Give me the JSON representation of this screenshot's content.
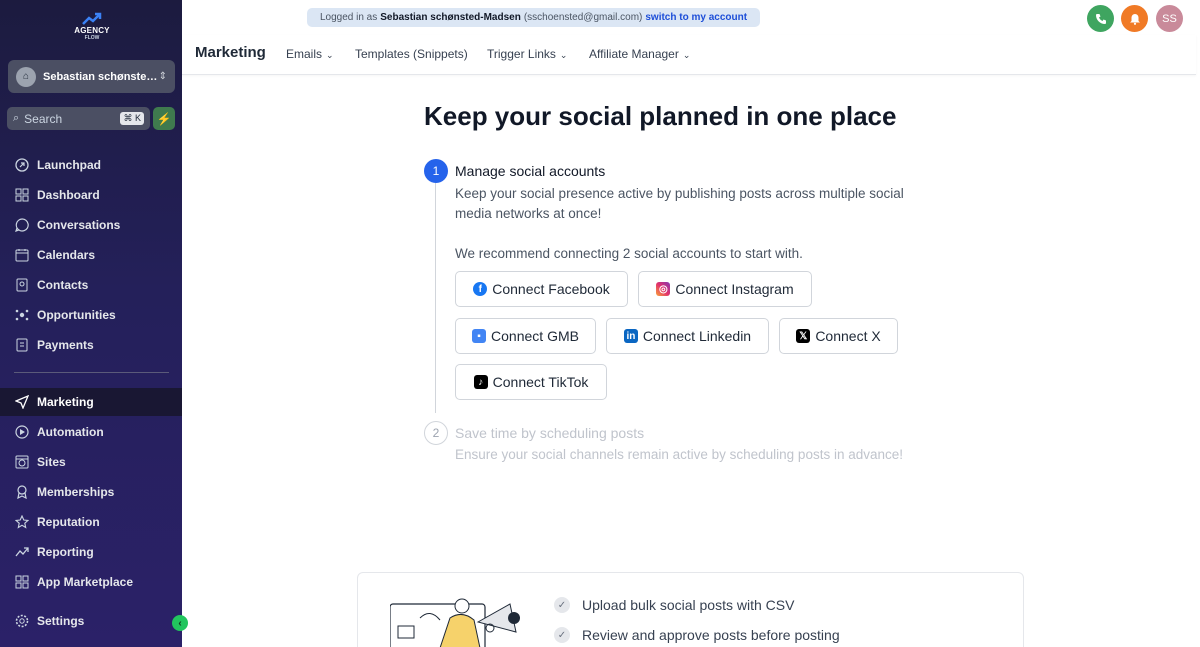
{
  "brand": {
    "logo_line1": "AGENCY",
    "logo_line2": "FLOW"
  },
  "account": {
    "name": "Sebastian schønste…"
  },
  "search": {
    "placeholder": "Search",
    "shortcut": "⌘ K"
  },
  "nav": [
    {
      "label": "Launchpad",
      "icon": "launchpad-icon"
    },
    {
      "label": "Dashboard",
      "icon": "dashboard-icon"
    },
    {
      "label": "Conversations",
      "icon": "chat-icon"
    },
    {
      "label": "Calendars",
      "icon": "calendar-icon"
    },
    {
      "label": "Contacts",
      "icon": "contacts-icon"
    },
    {
      "label": "Opportunities",
      "icon": "opportunities-icon"
    },
    {
      "label": "Payments",
      "icon": "payments-icon"
    },
    {
      "label": "Marketing",
      "icon": "send-icon",
      "active": true
    },
    {
      "label": "Automation",
      "icon": "automation-icon"
    },
    {
      "label": "Sites",
      "icon": "sites-icon"
    },
    {
      "label": "Memberships",
      "icon": "membership-icon"
    },
    {
      "label": "Reputation",
      "icon": "star-icon"
    },
    {
      "label": "Reporting",
      "icon": "reporting-icon"
    },
    {
      "label": "App Marketplace",
      "icon": "apps-icon"
    },
    {
      "label": "Settings",
      "icon": "gear-icon"
    }
  ],
  "banner": {
    "prefix": "Logged in as",
    "user": "Sebastian schønsted-Madsen",
    "email": "(sschoensted@gmail.com)",
    "switch_label": "switch to my account"
  },
  "topbar": {
    "avatar_initials": "SS",
    "colors": {
      "phone": "#3fa560",
      "bell": "#f07a26",
      "avatar": "#c98a9a"
    }
  },
  "header": {
    "title": "Marketing",
    "tabs": [
      {
        "label": "Emails",
        "has_dropdown": true
      },
      {
        "label": "Templates (Snippets)",
        "has_dropdown": false
      },
      {
        "label": "Trigger Links",
        "has_dropdown": true
      },
      {
        "label": "Affiliate Manager",
        "has_dropdown": true
      }
    ]
  },
  "main": {
    "title": "Keep your social planned in one place",
    "step1": {
      "number": "1",
      "title": "Manage social accounts",
      "desc_line1": "Keep your social presence active by publishing posts across multiple social",
      "desc_line2": "media networks at once!",
      "recommend": "We recommend connecting 2 social accounts to start with.",
      "buttons": {
        "facebook": "Connect Facebook",
        "instagram": "Connect Instagram",
        "gmb": "Connect GMB",
        "linkedin": "Connect Linkedin",
        "x": "Connect X",
        "tiktok": "Connect TikTok"
      }
    },
    "step2": {
      "number": "2",
      "title": "Save time by scheduling posts",
      "desc": "Ensure your social channels remain active by scheduling posts in advance!"
    }
  },
  "card": {
    "features": [
      "Upload bulk social posts with CSV",
      "Review and approve posts before posting"
    ]
  }
}
